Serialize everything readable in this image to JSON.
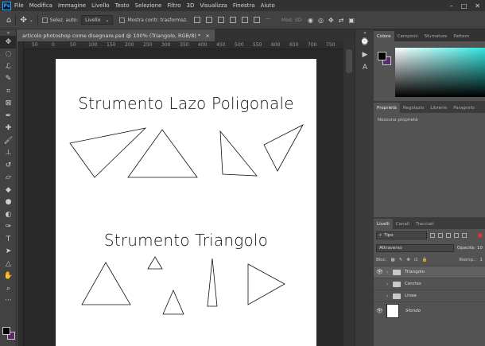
{
  "app": {
    "logo": "Ps",
    "menu": [
      "File",
      "Modifica",
      "Immagine",
      "Livello",
      "Testo",
      "Selezione",
      "Filtro",
      "3D",
      "Visualizza",
      "Finestra",
      "Aiuto"
    ],
    "window_controls": [
      "–",
      "□",
      "✕"
    ]
  },
  "options_bar": {
    "auto_select_label": "Selez. auto:",
    "auto_select_value": "Livello",
    "show_transform_label": "Mostra contr. trasformaz.",
    "mode_3d_label": "Mod. 3D:"
  },
  "document": {
    "tab_title": "articolo photoshop come disegnare.psd @ 100% (Triangolo, RGB/8) *",
    "tab_close": "×",
    "ruler_ticks": [
      "50",
      "0",
      "50",
      "100",
      "150",
      "200",
      "250",
      "300",
      "350",
      "400",
      "450",
      "500",
      "550",
      "600",
      "650",
      "700",
      "750",
      "800"
    ],
    "heading_1": "Strumento Lazo Poligonale",
    "heading_2": "Strumento Triangolo"
  },
  "panels": {
    "color_tabs": [
      "Colore",
      "Campioni",
      "Sfumature",
      "Pattern"
    ],
    "properties_tabs": [
      "Proprietà",
      "Regolazio",
      "Librerie",
      "Paragrafo"
    ],
    "properties_empty": "Nessuna proprietà",
    "layers_tabs": [
      "Livelli",
      "Canali",
      "Tracciati"
    ],
    "layer_filter": "Tipo",
    "blend_mode": "Attraverso",
    "opacity_label": "Opacità:",
    "opacity_value": "10",
    "lock_label": "Bloc:",
    "fill_label": "Riemp.:",
    "fill_value": "1",
    "layers": [
      {
        "name": "Triangolo",
        "visible": true,
        "type": "group",
        "selected": true
      },
      {
        "name": "Cerchio",
        "visible": false,
        "type": "group",
        "selected": false
      },
      {
        "name": "Linee",
        "visible": false,
        "type": "group",
        "selected": false
      },
      {
        "name": "Sfondo",
        "visible": true,
        "type": "background",
        "selected": false
      }
    ]
  },
  "colors": {
    "foreground": "#000000",
    "background": "#5a2a6a",
    "color_field_hue": "#33e6e0"
  }
}
